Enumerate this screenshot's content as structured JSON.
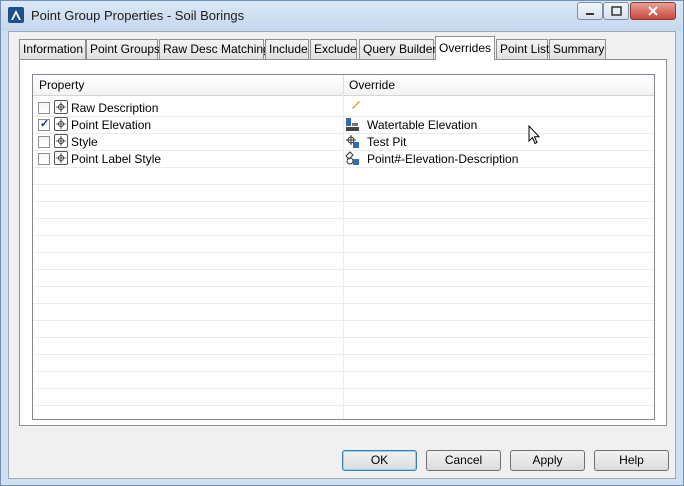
{
  "window": {
    "title": "Point Group Properties - Soil Borings",
    "close_glyph": "✕",
    "minimize_glyph": "▁",
    "maximize_glyph": "▢"
  },
  "tabs": [
    {
      "label": "Information"
    },
    {
      "label": "Point Groups"
    },
    {
      "label": "Raw Desc Matching"
    },
    {
      "label": "Include"
    },
    {
      "label": "Exclude"
    },
    {
      "label": "Query Builder"
    },
    {
      "label": "Overrides",
      "active": true
    },
    {
      "label": "Point List"
    },
    {
      "label": "Summary"
    }
  ],
  "grid": {
    "columns": {
      "property": "Property",
      "override": "Override"
    },
    "rows": [
      {
        "property": "Raw Description",
        "checked": false,
        "override": "",
        "override_icon": "pencil-icon"
      },
      {
        "property": "Point Elevation",
        "checked": true,
        "override": "Watertable Elevation",
        "override_icon": "elevation-icon"
      },
      {
        "property": "Style",
        "checked": false,
        "override": "Test Pit",
        "override_icon": "point-style-icon"
      },
      {
        "property": "Point Label Style",
        "checked": false,
        "override": "Point#-Elevation-Description",
        "override_icon": "label-style-icon"
      }
    ]
  },
  "buttons": {
    "ok": "OK",
    "cancel": "Cancel",
    "apply": "Apply",
    "help": "Help"
  },
  "colors": {
    "check": "#21327d",
    "window_frame": "#cfe0f2"
  }
}
